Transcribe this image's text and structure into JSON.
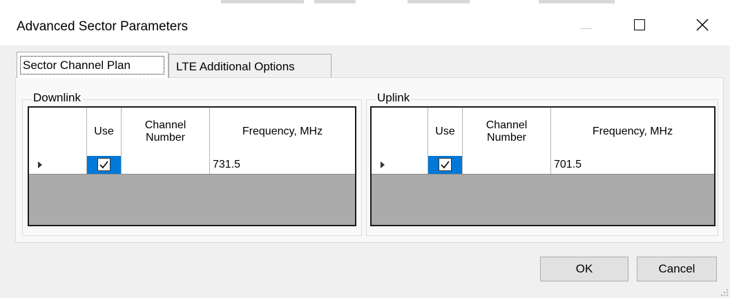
{
  "window": {
    "title": "Advanced Sector Parameters",
    "controls": {
      "minimize": "minimize-icon",
      "maximize": "maximize-icon",
      "close": "close-icon"
    }
  },
  "tabs": [
    {
      "label": "Sector Channel Plan",
      "active": true
    },
    {
      "label": "LTE Additional Options",
      "active": false
    }
  ],
  "downlink": {
    "group_label": "Downlink",
    "columns": [
      "",
      "Use",
      "Channel Number",
      "Frequency, MHz"
    ],
    "rows": [
      {
        "indicator": "current-row-arrow",
        "use": true,
        "channel_number": "",
        "frequency": "731.5"
      }
    ]
  },
  "uplink": {
    "group_label": "Uplink",
    "columns": [
      "",
      "Use",
      "Channel Number",
      "Frequency, MHz"
    ],
    "rows": [
      {
        "indicator": "current-row-arrow",
        "use": true,
        "channel_number": "",
        "frequency": "701.5"
      }
    ]
  },
  "buttons": {
    "ok": "OK",
    "cancel": "Cancel"
  },
  "colors": {
    "selected_cell": "#0078d7",
    "window_bg": "#f0f0f0",
    "tab_panel_bg": "#f9f9f9",
    "grid_empty_bg": "#ababab"
  }
}
